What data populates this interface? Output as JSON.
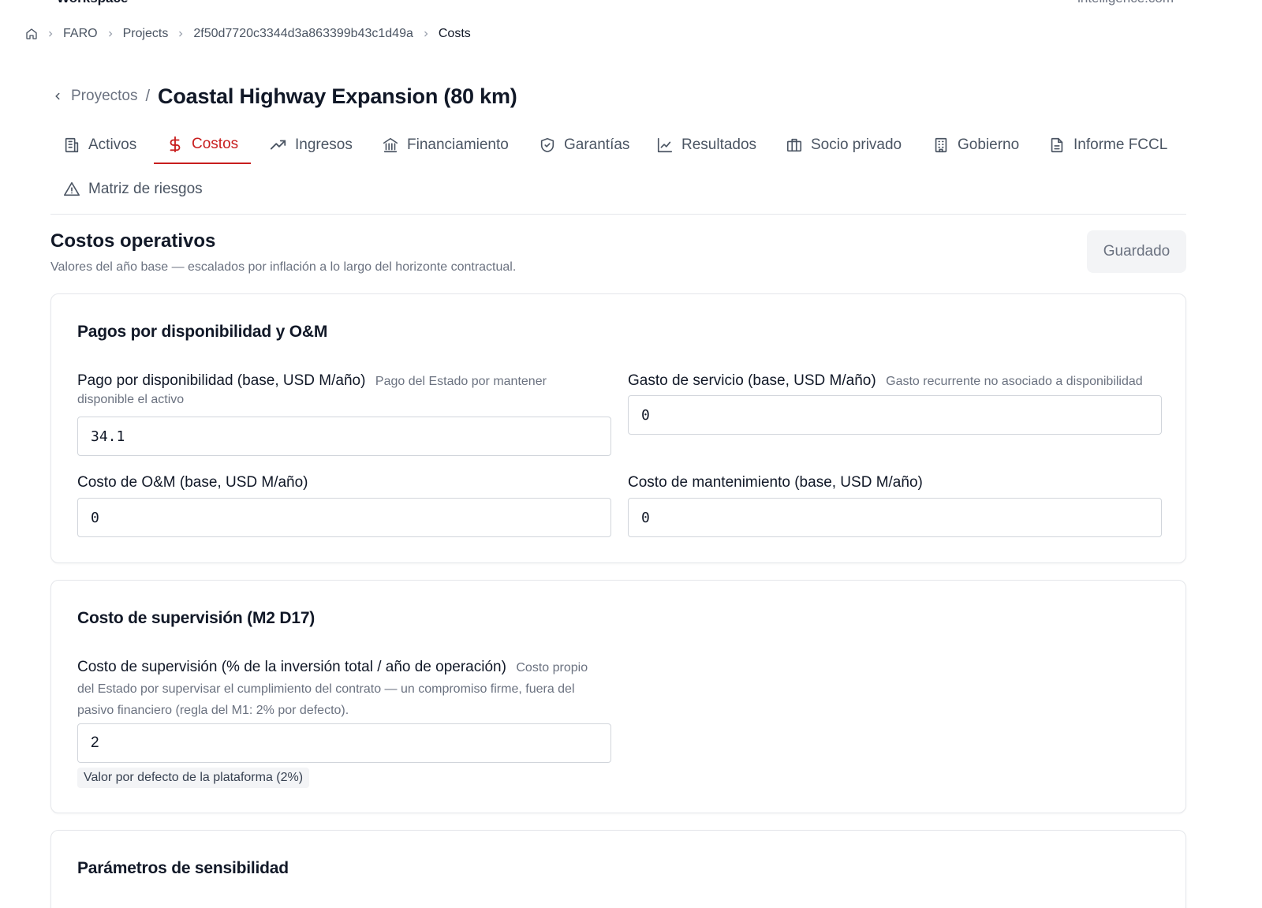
{
  "topbar": {
    "workspace": "Workspace",
    "domain": "intelligence.com"
  },
  "breadcrumb": [
    "FARO",
    "Projects",
    "2f50d7720c3344d3a863399b43c1d49a",
    "Costs"
  ],
  "header": {
    "back_label": "Proyectos",
    "separator": "/",
    "title": "Coastal Highway Expansion (80 km)"
  },
  "tabs": [
    {
      "label": "Activos",
      "icon": "building-icon"
    },
    {
      "label": "Costos",
      "icon": "dollar-icon",
      "active": true
    },
    {
      "label": "Ingresos",
      "icon": "trending-up-icon"
    },
    {
      "label": "Financiamiento",
      "icon": "bank-icon"
    },
    {
      "label": "Garantías",
      "icon": "shield-icon"
    },
    {
      "label": "Resultados",
      "icon": "line-chart-icon"
    },
    {
      "label": "Socio privado",
      "icon": "briefcase-icon"
    },
    {
      "label": "Gobierno",
      "icon": "office-building-icon"
    },
    {
      "label": "Informe FCCL",
      "icon": "document-icon"
    },
    {
      "label": "Matriz de riesgos",
      "icon": "warning-icon"
    }
  ],
  "section": {
    "title": "Costos operativos",
    "subtitle": "Valores del año base — escalados por inflación a lo largo del horizonte contractual.",
    "save_label": "Guardado"
  },
  "cards": {
    "payments": {
      "title": "Pagos por disponibilidad y O&M",
      "availability_payment": {
        "label": "Pago por disponibilidad (base, USD M/año)",
        "hint_1": "Pago del Estado por mantener",
        "hint_2": "disponible el activo",
        "value": "34.1"
      },
      "service_expense": {
        "label": "Gasto de servicio (base, USD M/año)",
        "hint": "Gasto recurrente no asociado a disponibilidad",
        "value": "0"
      },
      "om_cost": {
        "label": "Costo de O&M (base, USD M/año)",
        "value": "0"
      },
      "maintenance_cost": {
        "label": "Costo de mantenimiento (base, USD M/año)",
        "value": "0"
      }
    },
    "supervision": {
      "title": "Costo de supervisión (M2 D17)",
      "field": {
        "label": "Costo de supervisión (% de la inversión total / año de operación)",
        "hint_1": "Costo propio",
        "hint_2": "del Estado por supervisar el cumplimiento del contrato — un compromiso firme, fuera del",
        "hint_3": "pasivo financiero (regla del M1: 2% por defecto).",
        "value": "2",
        "default_badge": "Valor por defecto de la plataforma (2%)"
      }
    },
    "sensitivity": {
      "title": "Parámetros de sensibilidad"
    }
  },
  "colors": {
    "accent": "#c81e1e",
    "text": "#111827",
    "muted": "#6b7280",
    "border": "#e5e7eb"
  }
}
